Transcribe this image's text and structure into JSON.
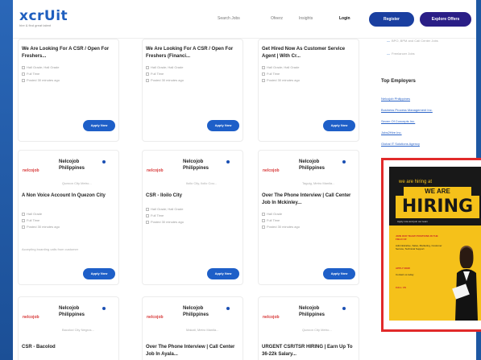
{
  "header": {
    "logo_text": "xcrUit",
    "logo_tagline": "hire & find great talent",
    "nav": [
      "Search Jobs",
      "Ofeerz",
      "Insights"
    ],
    "login": "Login",
    "register": "Register",
    "employer": "Explore Offers"
  },
  "cards_row1": [
    {
      "title": "We Are Looking For A CSR / Open For Freshers...",
      "meta": [
        "Hall Grade; Hall Grade",
        "Full Time",
        "Posted 30 minutes ago"
      ],
      "apply": "Apply Now"
    },
    {
      "title": "We Are Looking For A CSR / Open For Freshers (Financi...",
      "meta": [
        "Hall Grade; Hall Grade",
        "Full Time",
        "Posted 30 minutes ago"
      ],
      "apply": "Apply Now"
    },
    {
      "title": "Get Hired Now As Customer Service Agent | With Cr...",
      "meta": [
        "Hall Grade; Hall Grade",
        "Full Time",
        "Posted 30 minutes ago"
      ],
      "apply": "Apply Now"
    }
  ],
  "cards_row2": [
    {
      "company": "Nelcojob Philippines",
      "brand": "nelcojob",
      "location": "Quezon City Metro...",
      "title": "A Non Voice Account In Quezon City",
      "meta": [
        "Hall Grade",
        "Full Time",
        "Posted 30 minutes ago"
      ],
      "desc": "Accepting boarding calls from customer",
      "apply": "Apply Now"
    },
    {
      "company": "Nelcojob Philippines",
      "brand": "nelcojob",
      "location": "Iloilo City, Iloilo Cou...",
      "title": "CSR - Iloilo City",
      "meta": [
        "Hall Grade; Hall Grade",
        "Full Time",
        "Posted 30 minutes ago"
      ],
      "desc": "",
      "apply": "Apply Now"
    },
    {
      "company": "Nelcojob Philippines",
      "brand": "nelcojob",
      "location": "Taguig, Metro Manila...",
      "title": "Over The Phone Interview | Call Center Job In Mckinley...",
      "meta": [
        "Hall Grade",
        "Full Time",
        "Posted 30 minutes ago"
      ],
      "desc": "",
      "apply": "Apply Now"
    }
  ],
  "cards_row3": [
    {
      "company": "Nelcojob Philippines",
      "brand": "nelcojob",
      "location": "Bacolod City Negros...",
      "title": "CSR - Bacolod"
    },
    {
      "company": "Nelcojob Philippines",
      "brand": "nelcojob",
      "location": "Makati, Metro Manila...",
      "title": "Over The Phone Interview | Call Center Job In Ayala..."
    },
    {
      "company": "Nelcojob Philippines",
      "brand": "nelcojob",
      "location": "Quezon City Metro...",
      "title": "URGENT CSR/TSR HIRING | Earn Up To 36-22k Salary..."
    }
  ],
  "sidebar": {
    "lines": [
      "BPO, BPM and Call Center Jobs",
      "Freelancer Jobs"
    ],
    "top_employers_title": "Top Employers",
    "employers": [
      "Nelcojob Philippines",
      "Business Process Management Inc.",
      "Seven Of Concepts Inc.",
      "Jobs2Hire Inc.",
      "Global IT Solutions Agency"
    ]
  },
  "ad": {
    "line1": "we are hiring at",
    "line2": "WE ARE",
    "line3": "HIRING",
    "sub": "Apply now and join our team",
    "block1": "JOIN OUR TEAM! POSITIONS IN THE FIELD OF",
    "block2": "Administrative, Sales, Marketing, Customer Service, Technical Support",
    "block3": "APPLY NOW",
    "block4": "Contact us today",
    "block5": "CALL US"
  },
  "colors": {
    "brand_blue": "#1f5fbf",
    "apply_blue": "#1e5fc8",
    "ad_yellow": "#f5c11a",
    "ad_border": "#e12a2a"
  }
}
